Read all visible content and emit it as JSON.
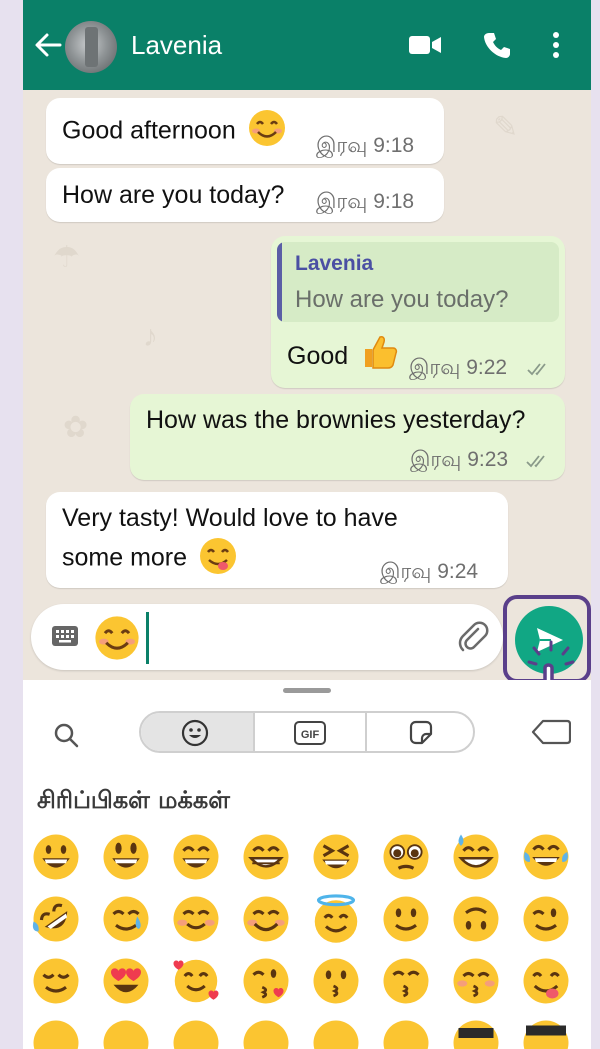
{
  "header": {
    "title": "Lavenia"
  },
  "messages": [
    {
      "dir": "in",
      "text": "Good afternoon",
      "time": "இரவு 9:18"
    },
    {
      "dir": "in",
      "text": "How are you today?",
      "time": "இரவு 9:18"
    },
    {
      "dir": "out",
      "quote_name": "Lavenia",
      "quote_text": "How are you today?",
      "text": "Good",
      "time": "இரவு 9:22"
    },
    {
      "dir": "out",
      "text": "How was the brownies yesterday?",
      "time": "இரவு 9:23"
    },
    {
      "dir": "in",
      "text_line1": "Very tasty! Would love to have",
      "text_line2": "some more",
      "time": "இரவு 9:24"
    }
  ],
  "composer": {
    "value_emoji": "smiling-face-emoji"
  },
  "emoji_panel": {
    "tab_gif": "GIF",
    "category": "சிரிப்பிகள் மக்கள்"
  },
  "colors": {
    "header": "#0a8068",
    "send": "#11a784",
    "highlight": "#5a3f8a"
  }
}
